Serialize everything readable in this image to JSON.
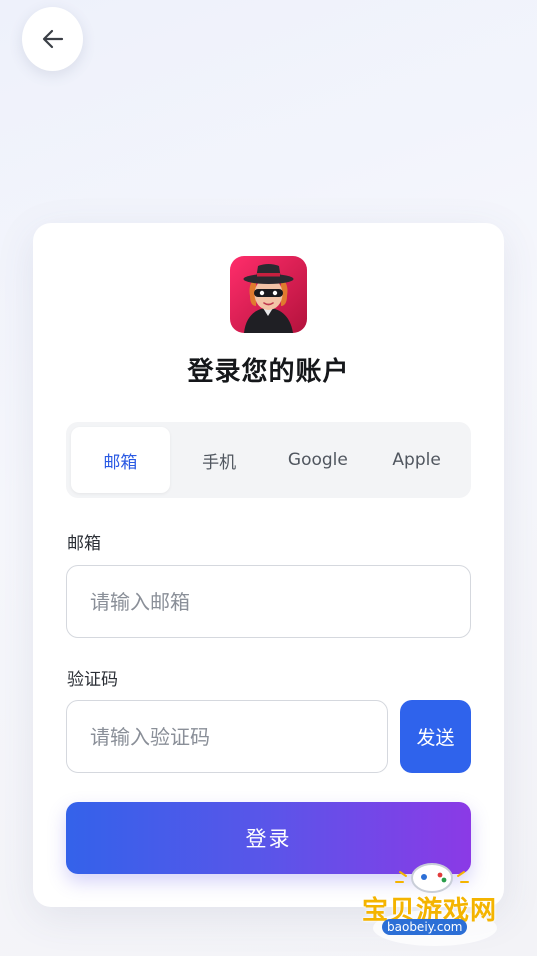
{
  "header": {
    "back_icon": "arrow-left-icon"
  },
  "login": {
    "title": "登录您的账户",
    "tabs": [
      {
        "label": "邮箱",
        "active": true
      },
      {
        "label": "手机",
        "active": false
      },
      {
        "label": "Google",
        "active": false
      },
      {
        "label": "Apple",
        "active": false
      }
    ],
    "email": {
      "label": "邮箱",
      "placeholder": "请输入邮箱",
      "value": ""
    },
    "code": {
      "label": "验证码",
      "placeholder": "请输入验证码",
      "value": ""
    },
    "send_label": "发送",
    "submit_label": "登录"
  },
  "watermark": {
    "name": "宝贝游戏网",
    "url": "baobeiy.com"
  },
  "colors": {
    "accent": "#2f63ec",
    "active_tab_text": "#2a5ae3",
    "gradient_start": "#3462ea",
    "gradient_end": "#8b3ae6",
    "watermark": "#f4b400"
  }
}
